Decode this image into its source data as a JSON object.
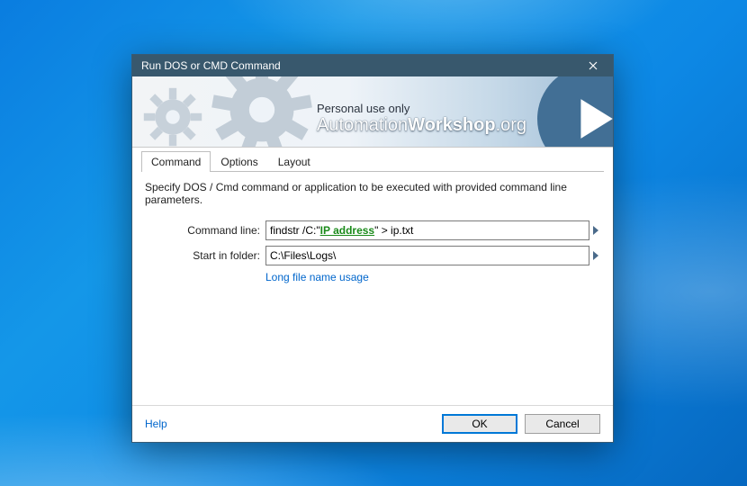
{
  "window": {
    "title": "Run DOS or CMD Command"
  },
  "banner": {
    "line1": "Personal use only",
    "line2_a": "Automation",
    "line2_b": "Workshop",
    "line2_c": ".org"
  },
  "tabs": [
    {
      "label": "Command",
      "active": true
    },
    {
      "label": "Options",
      "active": false
    },
    {
      "label": "Layout",
      "active": false
    }
  ],
  "description": "Specify DOS / Cmd command or application to be executed with provided command line parameters.",
  "fields": {
    "command_line": {
      "label": "Command line:",
      "value_prefix": "findstr /C:\"",
      "value_var": "IP address",
      "value_suffix": "\" > ip.txt"
    },
    "start_folder": {
      "label": "Start in folder:",
      "value": "C:\\Files\\Logs\\"
    }
  },
  "link_text": "Long file name usage",
  "footer": {
    "help": "Help",
    "ok": "OK",
    "cancel": "Cancel"
  }
}
